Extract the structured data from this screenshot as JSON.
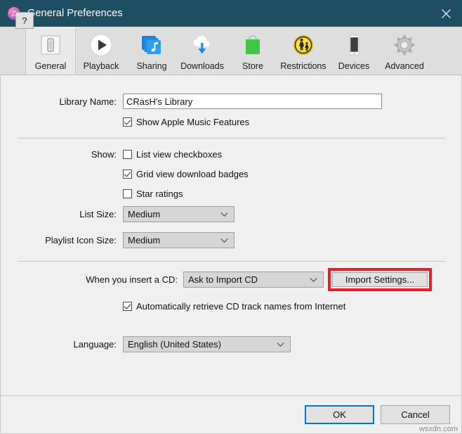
{
  "window": {
    "title": "General Preferences",
    "app_icon": "itunes-note-icon",
    "close_label": "×",
    "titlebar_color": "#1e4e5f"
  },
  "toolbar": {
    "tabs": [
      {
        "label": "General",
        "icon": "device-general-icon",
        "selected": true
      },
      {
        "label": "Playback",
        "icon": "play-circle-icon",
        "selected": false
      },
      {
        "label": "Sharing",
        "icon": "music-layers-icon",
        "selected": false
      },
      {
        "label": "Downloads",
        "icon": "cloud-download-icon",
        "selected": false
      },
      {
        "label": "Store",
        "icon": "shopping-bag-icon",
        "selected": false
      },
      {
        "label": "Restrictions",
        "icon": "parental-control-icon",
        "selected": false
      },
      {
        "label": "Devices",
        "icon": "iphone-icon",
        "selected": false
      },
      {
        "label": "Advanced",
        "icon": "gear-icon",
        "selected": false
      }
    ]
  },
  "form": {
    "library_name": {
      "label": "Library Name:",
      "value": "CRasH's Library"
    },
    "show_apple_music": {
      "label": "Show Apple Music Features",
      "checked": true
    },
    "show": {
      "label": "Show:",
      "options": [
        {
          "label": "List view checkboxes",
          "checked": false
        },
        {
          "label": "Grid view download badges",
          "checked": true
        },
        {
          "label": "Star ratings",
          "checked": false
        }
      ]
    },
    "list_size": {
      "label": "List Size:",
      "value": "Medium"
    },
    "playlist_icon_size": {
      "label": "Playlist Icon Size:",
      "value": "Medium"
    },
    "insert_cd": {
      "label": "When you insert a CD:",
      "value": "Ask to Import CD"
    },
    "import_settings_button": {
      "label": "Import Settings...",
      "highlight_color": "#ee1c24"
    },
    "auto_retrieve": {
      "label": "Automatically retrieve CD track names from Internet",
      "checked": true
    },
    "language": {
      "label": "Language:",
      "value": "English (United States)"
    }
  },
  "footer": {
    "help_label": "?",
    "ok_label": "OK",
    "cancel_label": "Cancel",
    "focus_color": "#0a74c8"
  },
  "watermark": "wsxdn.com"
}
